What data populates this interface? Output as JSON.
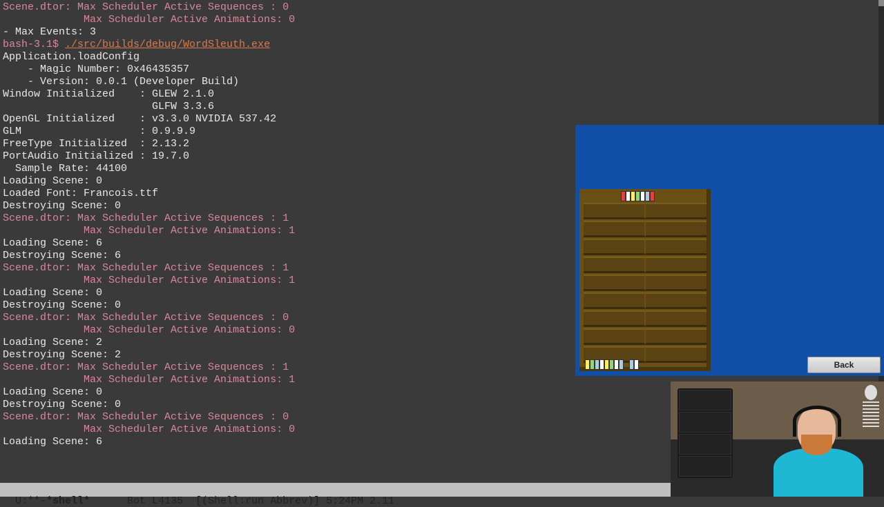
{
  "terminal": {
    "lines": [
      {
        "cls": "rose",
        "text": "Scene.dtor: Max Scheduler Active Sequences : 0"
      },
      {
        "cls": "rose",
        "text": "             Max Scheduler Active Animations: 0"
      },
      {
        "cls": "",
        "text": "- Max Events: 3"
      },
      {
        "cls": "promptline",
        "prompt": "bash-3.1$ ",
        "cmd": "./src/builds/debug/WordSleuth.exe"
      },
      {
        "cls": "",
        "text": "Application.loadConfig"
      },
      {
        "cls": "",
        "text": "    - Magic Number: 0x46435357"
      },
      {
        "cls": "",
        "text": "    - Version: 0.0.1 (Developer Build)"
      },
      {
        "cls": "",
        "text": "Window Initialized    : GLEW 2.1.0"
      },
      {
        "cls": "",
        "text": "                        GLFW 3.3.6"
      },
      {
        "cls": "",
        "text": "OpenGL Initialized    : v3.3.0 NVIDIA 537.42"
      },
      {
        "cls": "",
        "text": "GLM                   : 0.9.9.9"
      },
      {
        "cls": "",
        "text": "FreeType Initialized  : 2.13.2"
      },
      {
        "cls": "",
        "text": "PortAudio Initialized : 19.7.0"
      },
      {
        "cls": "",
        "text": "  Sample Rate: 44100"
      },
      {
        "cls": "",
        "text": "Loading Scene: 0"
      },
      {
        "cls": "",
        "text": "Loaded Font: Francois.ttf"
      },
      {
        "cls": "",
        "text": "Destroying Scene: 0"
      },
      {
        "cls": "rose",
        "text": "Scene.dtor: Max Scheduler Active Sequences : 1"
      },
      {
        "cls": "rose",
        "text": "             Max Scheduler Active Animations: 1"
      },
      {
        "cls": "",
        "text": "Loading Scene: 6"
      },
      {
        "cls": "",
        "text": "Destroying Scene: 6"
      },
      {
        "cls": "rose",
        "text": "Scene.dtor: Max Scheduler Active Sequences : 1"
      },
      {
        "cls": "rose",
        "text": "             Max Scheduler Active Animations: 1"
      },
      {
        "cls": "",
        "text": "Loading Scene: 0"
      },
      {
        "cls": "",
        "text": "Destroying Scene: 0"
      },
      {
        "cls": "rose",
        "text": "Scene.dtor: Max Scheduler Active Sequences : 0"
      },
      {
        "cls": "rose",
        "text": "             Max Scheduler Active Animations: 0"
      },
      {
        "cls": "",
        "text": "Loading Scene: 2"
      },
      {
        "cls": "",
        "text": "Destroying Scene: 2"
      },
      {
        "cls": "rose",
        "text": "Scene.dtor: Max Scheduler Active Sequences : 1"
      },
      {
        "cls": "rose",
        "text": "             Max Scheduler Active Animations: 1"
      },
      {
        "cls": "",
        "text": "Loading Scene: 0"
      },
      {
        "cls": "",
        "text": "Destroying Scene: 0"
      },
      {
        "cls": "rose",
        "text": "Scene.dtor: Max Scheduler Active Sequences : 0"
      },
      {
        "cls": "rose",
        "text": "             Max Scheduler Active Animations: 0"
      },
      {
        "cls": "",
        "text": "Loading Scene: 6"
      }
    ]
  },
  "modeline": {
    "left": "U:**-",
    "buffer": "*shell*",
    "mid": "      Bot L4135  [(Shell:run Abbrev)] 5:24PM 2.11"
  },
  "game": {
    "back_label": "Back",
    "book_colors_top": [
      "#d44",
      "#fff",
      "#fe6",
      "#8d6",
      "#fff",
      "#acd",
      "#d44"
    ],
    "book_colors_bottom_a": [
      "#fe6",
      "#8d6",
      "#acd",
      "#fff",
      "#fe6",
      "#8d6",
      "#fff",
      "#acd"
    ],
    "book_colors_bottom_b": [
      "#acd",
      "#fff"
    ]
  }
}
